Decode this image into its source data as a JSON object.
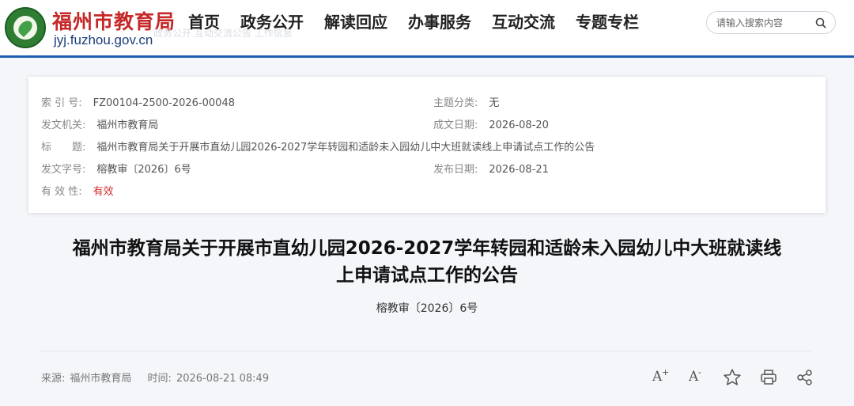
{
  "header": {
    "site_name": "福州市教育局",
    "domain": "jyj.fuzhou.gov.cn",
    "ghost_text": "政务公开   互动交流公告   工作信息",
    "nav": [
      "首页",
      "政务公开",
      "解读回应",
      "办事服务",
      "互动交流",
      "专题专栏"
    ],
    "search_placeholder": "请输入搜索内容"
  },
  "info": {
    "index_label": "索 引 号:",
    "index_value": "FZ00104-2500-2026-00048",
    "category_label": "主题分类:",
    "category_value": "无",
    "issuer_label": "发文机关:",
    "issuer_value": "福州市教育局",
    "created_label": "成文日期:",
    "created_value": "2026-08-20",
    "title_label": "标　　题:",
    "title_value": "福州市教育局关于开展市直幼儿园2026-2027学年转园和适龄未入园幼儿中大班就读线上申请试点工作的公告",
    "doc_no_label": "发文字号:",
    "doc_no_value": "榕教审〔2026〕6号",
    "published_label": "发布日期:",
    "published_value": "2026-08-21",
    "validity_label": "有 效 性:",
    "validity_value": "有效"
  },
  "article": {
    "title_line1": "福州市教育局关于开展市直幼儿园2026-2027学年转园和适龄未入园幼儿中大班就读线",
    "title_line2": "上申请试点工作的公告",
    "doc_number": "榕教审〔2026〕6号",
    "source_label": "来源:",
    "source_value": "福州市教育局",
    "time_label": "时间:",
    "time_value": "2026-08-21 08:49"
  },
  "tools": {
    "font_glyph": "A",
    "font_larger": "+",
    "font_smaller": "-",
    "icons": [
      "font-increase-icon",
      "font-decrease-icon",
      "favorite-star-icon",
      "print-icon",
      "share-icon"
    ]
  },
  "colors": {
    "header_bar": "#1f5fb0",
    "site_name": "#c62828",
    "validity": "#d32f2f"
  }
}
